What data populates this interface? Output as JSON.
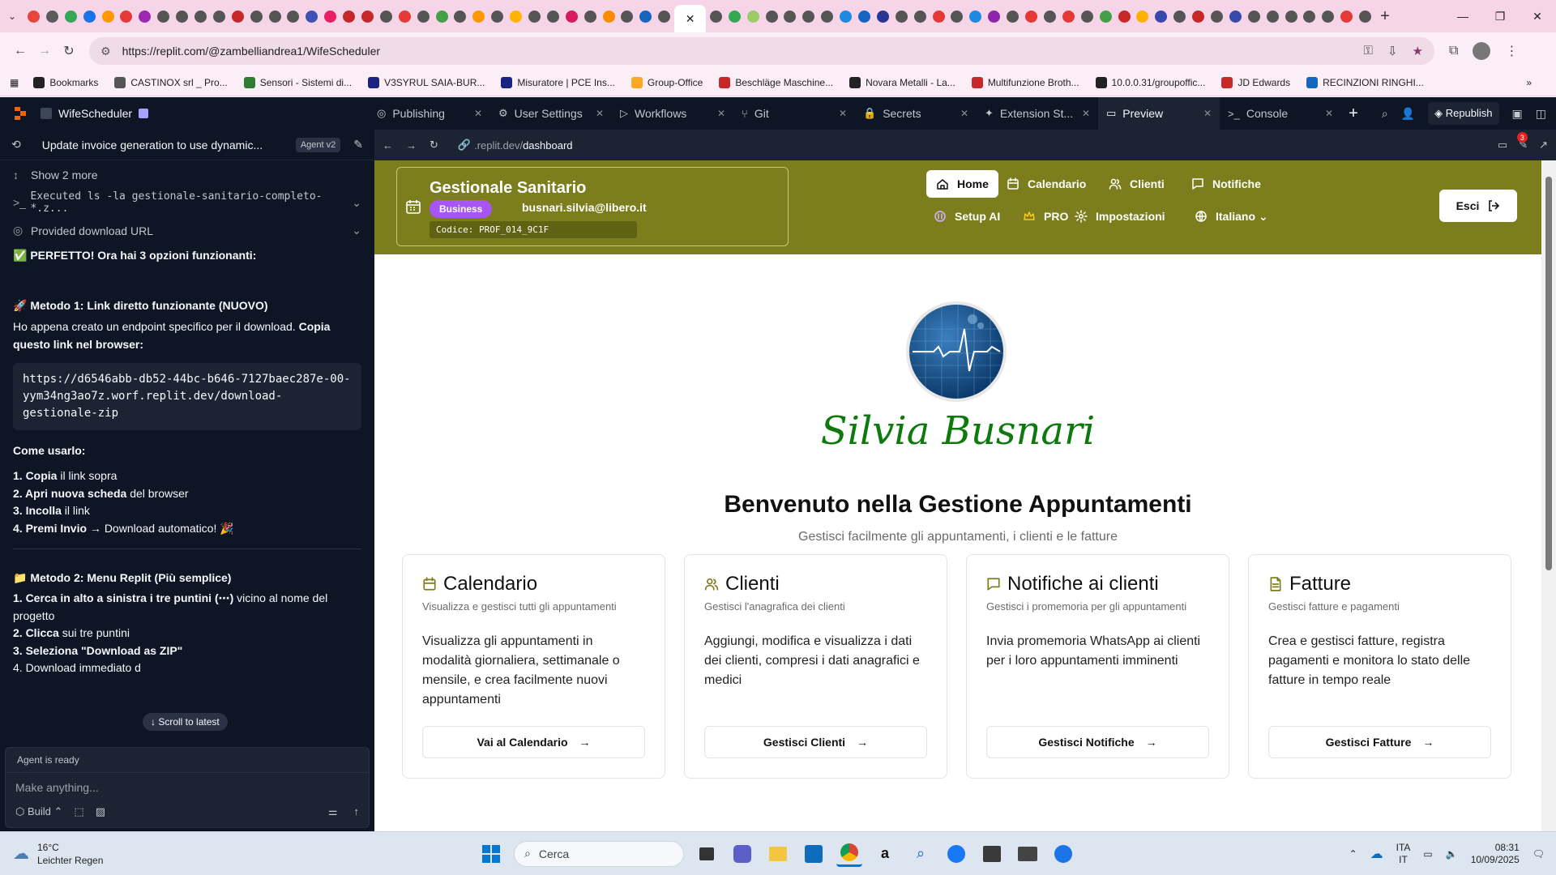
{
  "browser": {
    "url": "https://replit.com/@zambelliandrea1/WifeScheduler",
    "tab_favicon_colors": [
      "#e8453c",
      "#5b5b5b",
      "#34a853",
      "#1a73e8",
      "#ff9800",
      "#e53935",
      "#9c27b0",
      "#555555",
      "#555555",
      "#555555",
      "#555555",
      "#c62828",
      "#555555",
      "#555555",
      "#555555",
      "#3f51b5",
      "#e91e63",
      "#c62828",
      "#c62828",
      "#555555",
      "#e53935",
      "#555555",
      "#43a047",
      "#555555",
      "#ff9800",
      "#555555",
      "#ffb300",
      "#555555",
      "#555555",
      "#d81b60",
      "#555555",
      "#fb8c00",
      "#555555",
      "#1565c0",
      "#555555"
    ],
    "tab_favicon_colors_right": [
      "#555555",
      "#34a853",
      "#9ccc65",
      "#555555",
      "#555555",
      "#555555",
      "#555555",
      "#1e88e5",
      "#1565c0",
      "#283593",
      "#555555",
      "#555555",
      "#e53935",
      "#555555",
      "#1e88e5",
      "#8e24aa",
      "#555555",
      "#e53935",
      "#555555",
      "#e53935",
      "#555555",
      "#43a047",
      "#c62828",
      "#ffb300",
      "#3949ab",
      "#555555",
      "#c62828",
      "#555555",
      "#3949ab",
      "#555555",
      "#555555",
      "#555555",
      "#555555",
      "#555555",
      "#e53935",
      "#555555"
    ],
    "bookmarks": [
      {
        "label": "Bookmarks",
        "color": "#222222"
      },
      {
        "label": "CASTINOX srl _ Pro...",
        "color": "#555555"
      },
      {
        "label": "Sensori - Sistemi di...",
        "color": "#2e7d32"
      },
      {
        "label": "V3SYRUL SAIA-BUR...",
        "color": "#1a237e"
      },
      {
        "label": "Misuratore | PCE Ins...",
        "color": "#1a237e"
      },
      {
        "label": "Group-Office",
        "color": "#f9a825"
      },
      {
        "label": "Beschläge Maschine...",
        "color": "#c62828"
      },
      {
        "label": "Novara Metalli - La...",
        "color": "#222222"
      },
      {
        "label": "Multifunzione Broth...",
        "color": "#c62828"
      },
      {
        "label": "10.0.0.31/groupoffic...",
        "color": "#222222"
      },
      {
        "label": "JD Edwards",
        "color": "#c62828"
      },
      {
        "label": "RECINZIONI RINGHI...",
        "color": "#1565c0"
      }
    ]
  },
  "replit": {
    "project_name": "WifeScheduler",
    "tabs": [
      {
        "label": "Publishing",
        "icon": "globe"
      },
      {
        "label": "User Settings",
        "icon": "gear"
      },
      {
        "label": "Workflows",
        "icon": "play"
      },
      {
        "label": "Git",
        "icon": "branch"
      },
      {
        "label": "Secrets",
        "icon": "lock"
      },
      {
        "label": "Extension St...",
        "icon": "puzzle"
      },
      {
        "label": "Preview",
        "icon": "monitor"
      },
      {
        "label": "Console",
        "icon": "terminal"
      }
    ],
    "republish_label": "Republish",
    "chat": {
      "title": "Update invoice generation to use dynamic...",
      "badge": "Agent v2",
      "show_more": "Show 2 more",
      "executed": "Executed ls -la gestionale-sanitario-completo-*.z...",
      "provided": "Provided download URL",
      "perfetto": "✅ PERFETTO! Ora hai 3 opzioni funzionanti:",
      "metodo1_title": "🚀 Metodo 1: Link diretto funzionante (NUOVO)",
      "metodo1_text": "Ho appena creato un endpoint specifico per il download.",
      "metodo1_bold": "Copia questo link nel browser:",
      "code": "https://d6546abb-db52-44bc-b646-7127baec287e-00-yym34ng3ao7z.worf.replit.dev/download-gestionale-zip",
      "come_usarlo": "Come usarlo:",
      "steps1": [
        {
          "bold": "1. Copia",
          "rest": " il link sopra"
        },
        {
          "bold": "2. Apri nuova scheda",
          "rest": " del browser"
        },
        {
          "bold": "3. Incolla",
          "rest": " il link"
        },
        {
          "bold": "4. Premi Invio",
          "rest": " → Download automatico! 🎉"
        }
      ],
      "metodo2_title": "📁 Metodo 2: Menu Replit (Più semplice)",
      "steps2": [
        {
          "bold": "1. Cerca in alto a sinistra i tre puntini (⋯)",
          "rest": " vicino al nome del progetto"
        },
        {
          "bold": "2. Clicca",
          "rest": " sui tre puntini"
        },
        {
          "bold": "3. Seleziona \"Download as ZIP\"",
          "rest": ""
        },
        {
          "bold": "",
          "rest": "4. Download immediato d"
        }
      ],
      "scroll_latest": "Scroll to latest",
      "status": "Agent is ready",
      "input_placeholder": "Make anything...",
      "build_label": "Build"
    },
    "preview": {
      "url_host": ".replit.dev/",
      "url_path": "dashboard",
      "notification_count": "3"
    }
  },
  "app": {
    "header_color": "#7c7e1e",
    "brand_name": "Gestionale Sanitario",
    "plan_badge": "Business",
    "email": "busnari.silvia@libero.it",
    "code": "Codice: PROF_014_9C1F",
    "nav_row1": [
      {
        "label": "Home",
        "icon": "home"
      },
      {
        "label": "Calendario",
        "icon": "calendar"
      },
      {
        "label": "Clienti",
        "icon": "users"
      },
      {
        "label": "Notifiche",
        "icon": "message"
      }
    ],
    "nav_row2": [
      {
        "label": "Setup AI",
        "icon": "ai"
      },
      {
        "label": "PRO",
        "icon": "crown"
      },
      {
        "label": "Impostazioni",
        "icon": "gear"
      },
      {
        "label": "Italiano",
        "icon": "globe"
      }
    ],
    "logout_label": "Esci",
    "hero_name": "Silvia Busnari",
    "welcome_title": "Benvenuto nella Gestione Appuntamenti",
    "welcome_subtitle": "Gestisci facilmente gli appuntamenti, i clienti e le fatture",
    "cards": [
      {
        "title": "Calendario",
        "subtitle": "Visualizza e gestisci tutti gli appuntamenti",
        "body": "Visualizza gli appuntamenti in modalità giornaliera, settimanale o mensile, e crea facilmente nuovi appuntamenti",
        "button": "Vai al Calendario",
        "icon": "calendar"
      },
      {
        "title": "Clienti",
        "subtitle": "Gestisci l'anagrafica dei clienti",
        "body": "Aggiungi, modifica e visualizza i dati dei clienti, compresi i dati anagrafici e medici",
        "button": "Gestisci Clienti",
        "icon": "users"
      },
      {
        "title": "Notifiche ai clienti",
        "subtitle": "Gestisci i promemoria per gli appuntamenti",
        "body": "Invia promemoria WhatsApp ai clienti per i loro appuntamenti imminenti",
        "button": "Gestisci Notifiche",
        "icon": "message"
      },
      {
        "title": "Fatture",
        "subtitle": "Gestisci fatture e pagamenti",
        "body": "Crea e gestisci fatture, registra pagamenti e monitora lo stato delle fatture in tempo reale",
        "button": "Gestisci Fatture",
        "icon": "file"
      }
    ]
  },
  "taskbar": {
    "temperature": "16°C",
    "weather": "Leichter Regen",
    "search_placeholder": "Cerca",
    "lang_1": "ITA",
    "lang_2": "IT",
    "time": "08:31",
    "date": "10/09/2025"
  }
}
